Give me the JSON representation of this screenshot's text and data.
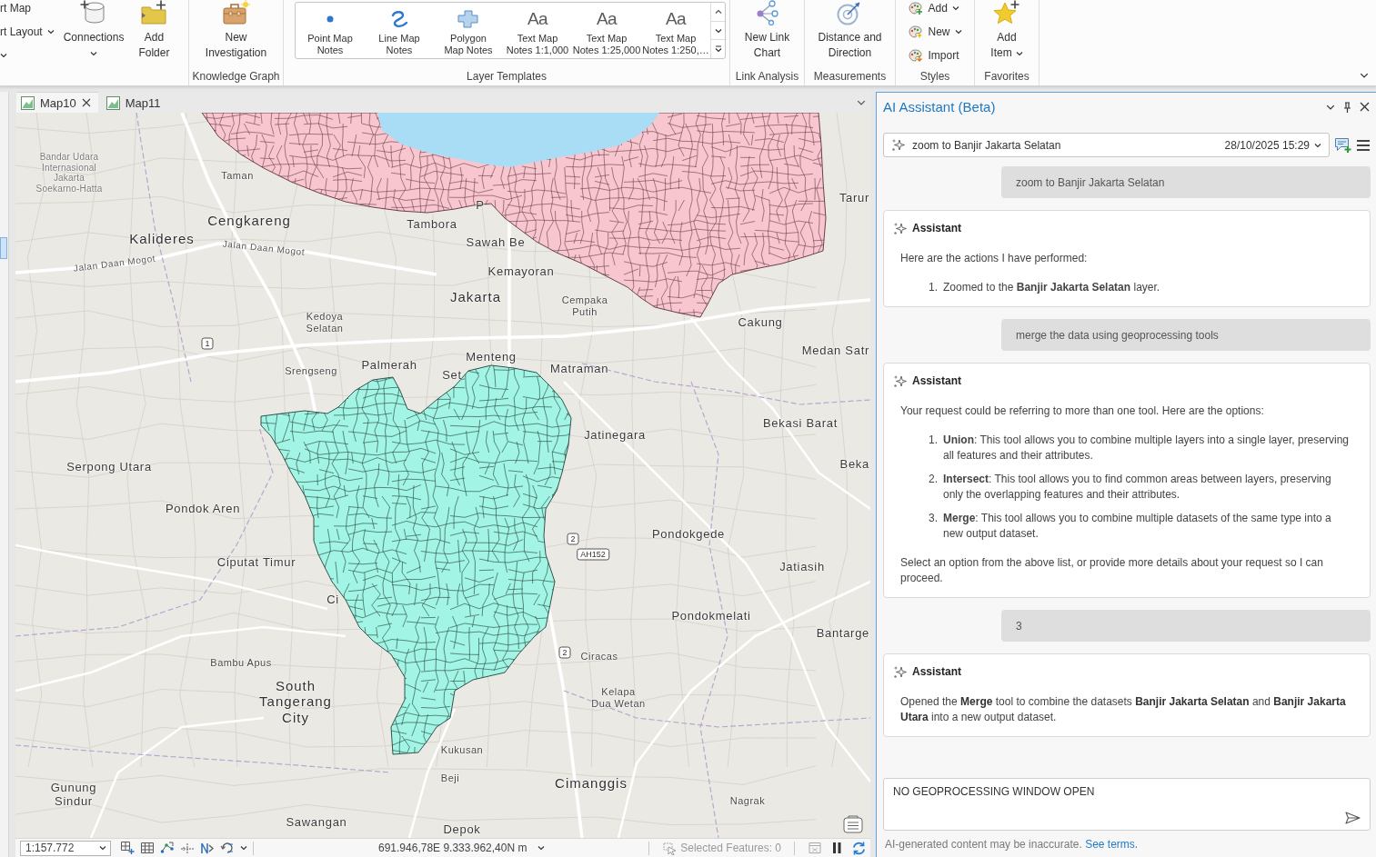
{
  "ribbon": {
    "groups": [
      {
        "items": [
          {
            "kind": "stack",
            "rows": [
              {
                "label": "rt Map",
                "dropdown": false
              },
              {
                "label": "rt Layout",
                "dropdown": true
              },
              {
                "dropdown": true
              }
            ]
          },
          {
            "kind": "large",
            "label": [
              "Connections"
            ],
            "dropdown": true
          },
          {
            "kind": "large",
            "label": [
              "Add",
              "Folder"
            ],
            "dropdown": false
          }
        ]
      },
      {
        "label": "Knowledge Graph",
        "items": [
          {
            "kind": "large",
            "label": [
              "New",
              "Investigation"
            ],
            "dropdown": false
          }
        ]
      },
      {
        "label": "Layer Templates",
        "items": [
          {
            "kind": "gallery",
            "entries": [
              {
                "kind": "point",
                "label": [
                  "Point Map",
                  "Notes"
                ]
              },
              {
                "kind": "line",
                "label": [
                  "Line Map",
                  "Notes"
                ]
              },
              {
                "kind": "polygon",
                "label": [
                  "Polygon",
                  "Map Notes"
                ]
              },
              {
                "kind": "text",
                "glyph": "Aa",
                "label": [
                  "Text Map",
                  "Notes 1:1,000"
                ]
              },
              {
                "kind": "text",
                "glyph": "Aa",
                "label": [
                  "Text Map",
                  "Notes 1:25,000"
                ]
              },
              {
                "kind": "text",
                "glyph": "Aa",
                "label": [
                  "Text Map",
                  "Notes 1:250,…"
                ]
              }
            ]
          }
        ]
      },
      {
        "label": "Link Analysis",
        "items": [
          {
            "kind": "large",
            "label": [
              "New Link",
              "Chart"
            ],
            "dropdown": false
          }
        ]
      },
      {
        "label": "Measurements",
        "items": [
          {
            "kind": "large",
            "label": [
              "Distance and",
              "Direction"
            ],
            "dropdown": false
          }
        ]
      },
      {
        "label": "Styles",
        "items": [
          {
            "kind": "stack",
            "rows": [
              {
                "label": "Add",
                "dropdown": true
              },
              {
                "label": "New",
                "dropdown": true
              },
              {
                "label": "Import",
                "dropdown": false
              }
            ]
          }
        ]
      },
      {
        "label": "Favorites",
        "items": [
          {
            "kind": "large",
            "label": [
              "Add",
              "Item"
            ],
            "dropdown": true
          }
        ]
      }
    ]
  },
  "map_tabs": [
    {
      "label": "Map10",
      "selected": true
    },
    {
      "label": "Map11",
      "selected": false
    }
  ],
  "map": {
    "labels": [
      {
        "kind": "airport",
        "text": "Bandar Udara Internasional Jakarta Soekarno-Hatta"
      },
      {
        "kind": "minor",
        "text": "Taman"
      },
      {
        "kind": "major",
        "text": "Cengkareng"
      },
      {
        "kind": "major",
        "text": "Kalideres"
      },
      {
        "kind": "road",
        "text": "Jalan Daan Mogot"
      },
      {
        "kind": "road",
        "text": "Jalan Daan Mogot"
      },
      {
        "kind": "medium",
        "text": "Tambora"
      },
      {
        "kind": "medium",
        "text": "P"
      },
      {
        "kind": "medium",
        "text": "Sawah Be"
      },
      {
        "kind": "medium",
        "text": "Kemayoran"
      },
      {
        "kind": "major",
        "text": "Jakarta"
      },
      {
        "kind": "minor",
        "text": "Cempaka Putih"
      },
      {
        "kind": "medium",
        "text": "Tarur"
      },
      {
        "kind": "medium",
        "text": "Cakung"
      },
      {
        "kind": "medium",
        "text": "Medan Satr"
      },
      {
        "kind": "minor",
        "text": "Kedoya Selatan"
      },
      {
        "kind": "shield",
        "text": "1"
      },
      {
        "kind": "minor",
        "text": "Srengseng"
      },
      {
        "kind": "medium",
        "text": "Palmerah"
      },
      {
        "kind": "medium",
        "text": "Set"
      },
      {
        "kind": "medium",
        "text": "Menteng"
      },
      {
        "kind": "medium",
        "text": "Matraman"
      },
      {
        "kind": "medium",
        "text": "Bekasi Barat"
      },
      {
        "kind": "medium",
        "text": "Jatinegara"
      },
      {
        "kind": "medium",
        "text": "Beka"
      },
      {
        "kind": "medium",
        "text": "Serpong Utara"
      },
      {
        "kind": "medium",
        "text": "Pondok Aren"
      },
      {
        "kind": "medium",
        "text": "Pondokgede"
      },
      {
        "kind": "shield",
        "text": "2"
      },
      {
        "kind": "shield",
        "text": "AH152"
      },
      {
        "kind": "medium",
        "text": "Ciputat Timur"
      },
      {
        "kind": "medium",
        "text": "Jatiasih"
      },
      {
        "kind": "medium",
        "text": "Ci"
      },
      {
        "kind": "medium",
        "text": "Pondokmelati"
      },
      {
        "kind": "medium",
        "text": "Bantarge"
      },
      {
        "kind": "shield",
        "text": "2"
      },
      {
        "kind": "minor",
        "text": "Ciracas"
      },
      {
        "kind": "minor",
        "text": "Bambu Apus"
      },
      {
        "kind": "major",
        "text": "South Tangerang City"
      },
      {
        "kind": "minor",
        "text": "Kelapa Dua Wetan"
      },
      {
        "kind": "minor",
        "text": "Kukusan"
      },
      {
        "kind": "minor",
        "text": "Beji"
      },
      {
        "kind": "medium",
        "text": "Gunung Sindur"
      },
      {
        "kind": "major",
        "text": "Cimanggis"
      },
      {
        "kind": "minor",
        "text": "Nagrak"
      },
      {
        "kind": "medium",
        "text": "Sawangan"
      },
      {
        "kind": "medium",
        "text": "Depok"
      }
    ]
  },
  "status_bar": {
    "scale": "1:157.772",
    "coordinates": "691.946,78E 9.333.962,40N m",
    "selection": {
      "label": "Selected Features: 0",
      "disabled": true
    }
  },
  "assistant_panel": {
    "title": "AI Assistant (Beta)",
    "conversation": {
      "title": "zoom to Banjir Jakarta Selatan",
      "date": "28/10/2025 15:29"
    },
    "messages": [
      {
        "kind": "user",
        "text": "zoom to Banjir Jakarta Selatan"
      },
      {
        "kind": "assistant",
        "sender": "Assistant",
        "blocks": [
          {
            "kind": "paragraph",
            "text": "Here are the actions I have performed:"
          },
          {
            "kind": "list",
            "items": [
              {
                "number": "1.",
                "text": "Zoomed to the **Banjir Jakarta Selatan** layer."
              }
            ]
          }
        ]
      },
      {
        "kind": "user",
        "text": "merge the data using geoprocessing tools"
      },
      {
        "kind": "assistant",
        "sender": "Assistant",
        "blocks": [
          {
            "kind": "paragraph",
            "text": "Your request could be referring to more than one tool. Here are the options:"
          },
          {
            "kind": "list",
            "items": [
              {
                "number": "1.",
                "text": "**Union**: This tool allows you to combine multiple layers into a single layer, preserving all features and their attributes."
              },
              {
                "number": "2.",
                "text": "**Intersect**: This tool allows you to find common areas between layers, preserving only the overlapping features and their attributes."
              },
              {
                "number": "3.",
                "text": "**Merge**: This tool allows you to combine multiple datasets of the same type into a new output dataset."
              }
            ]
          },
          {
            "kind": "paragraph",
            "text": "Select an option from the above list, or provide more details about your request so I can proceed."
          }
        ]
      },
      {
        "kind": "user",
        "text": "3"
      },
      {
        "kind": "assistant",
        "sender": "Assistant",
        "blocks": [
          {
            "kind": "paragraph",
            "text": "Opened the **Merge** tool to combine the datasets **Banjir Jakarta Selatan** and **Banjir Jakarta Utara** into a new output dataset."
          }
        ]
      }
    ],
    "input": {
      "value": "NO GEOPROCESSING WINDOW OPEN"
    },
    "disclaimer": "AI-generated content may be inaccurate.",
    "terms_link": "See terms."
  }
}
